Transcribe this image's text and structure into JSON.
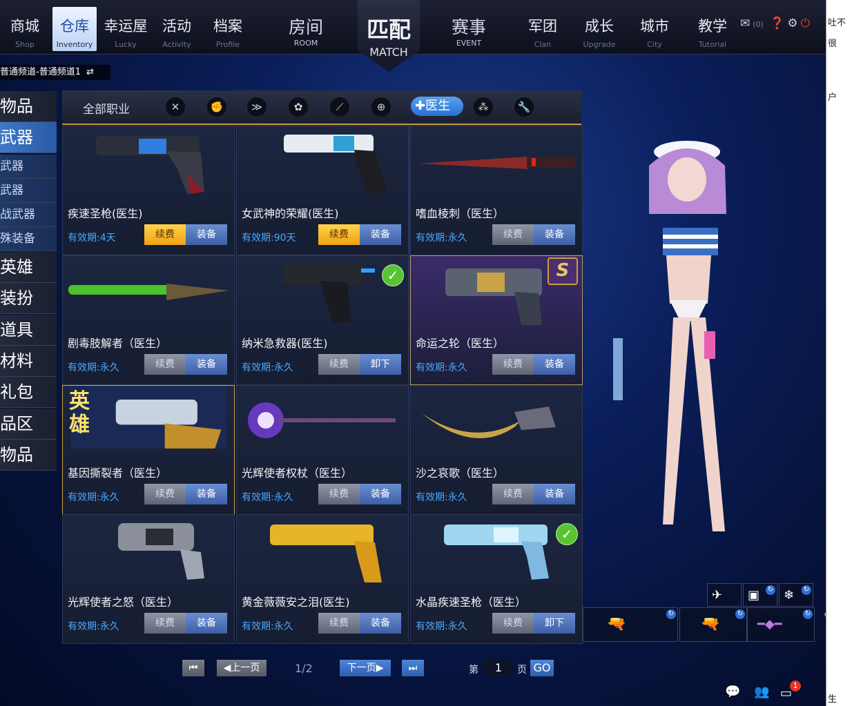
{
  "nav": {
    "items": [
      {
        "cn": "商城",
        "en": "Shop"
      },
      {
        "cn": "仓库",
        "en": "Inventory"
      },
      {
        "cn": "幸运屋",
        "en": "Lucky"
      },
      {
        "cn": "活动",
        "en": "Activity"
      },
      {
        "cn": "档案",
        "en": "Profile"
      }
    ],
    "big_left": {
      "cn": "房间",
      "en": "ROOM"
    },
    "match": {
      "cn": "匹配",
      "en": "MATCH"
    },
    "big_right": {
      "cn": "赛事",
      "en": "EVENT"
    },
    "right_items": [
      {
        "cn": "军团",
        "en": "Clan"
      },
      {
        "cn": "成长",
        "en": "Upgrade"
      },
      {
        "cn": "城市",
        "en": "City"
      },
      {
        "cn": "教学",
        "en": "Tutorial"
      }
    ],
    "mail_count": "(0)"
  },
  "channel": "普通频道-普通频道1",
  "categories": {
    "big1": "物品",
    "weapon": "武器",
    "subs": [
      "武器",
      "武器",
      "战武器",
      "殊装备"
    ],
    "big": [
      "英雄",
      "装扮",
      "道具",
      "材料",
      "礼包",
      "品区",
      "物品"
    ]
  },
  "filter": {
    "all_jobs": "全部职业",
    "doctor": "医生"
  },
  "items": [
    {
      "name": "疾速圣枪(医生)",
      "valid": "有效期:4天",
      "renew": "续费",
      "action": "装备"
    },
    {
      "name": "女武神的荣耀(医生)",
      "valid": "有效期:90天",
      "renew": "续费",
      "action": "装备"
    },
    {
      "name": "嗜血棱刺（医生）",
      "valid": "有效期:永久",
      "renew": "续费",
      "action": "装备"
    },
    {
      "name": "剧毒肢解者（医生）",
      "valid": "有效期:永久",
      "renew": "续费",
      "action": "装备"
    },
    {
      "name": "纳米急救器(医生)",
      "valid": "有效期:永久",
      "renew": "续费",
      "action": "卸下"
    },
    {
      "name": "命运之轮（医生）",
      "valid": "有效期:永久",
      "renew": "续费",
      "action": "装备"
    },
    {
      "name": "基因撕裂者（医生）",
      "valid": "有效期:永久",
      "renew": "续费",
      "action": "装备"
    },
    {
      "name": "光辉使者权杖（医生）",
      "valid": "有效期:永久",
      "renew": "续费",
      "action": "装备"
    },
    {
      "name": "沙之哀歌（医生）",
      "valid": "有效期:永久",
      "renew": "续费",
      "action": "装备"
    },
    {
      "name": "光辉使者之怒（医生）",
      "valid": "有效期:永久",
      "renew": "续费",
      "action": "装备"
    },
    {
      "name": "黄金薇薇安之泪(医生)",
      "valid": "有效期:永久",
      "renew": "续费",
      "action": "装备"
    },
    {
      "name": "水晶疾速圣枪（医生）",
      "valid": "有效期:永久",
      "renew": "续费",
      "action": "卸下"
    }
  ],
  "hero_badge": "英雄",
  "pager": {
    "prev": "上一页",
    "next": "下一页",
    "page": "1/2",
    "di": "第",
    "page_input": "1",
    "ye": "页",
    "go": "GO"
  },
  "notif_count": "1",
  "right_pane": [
    "吐不",
    "很",
    "户",
    "生"
  ]
}
